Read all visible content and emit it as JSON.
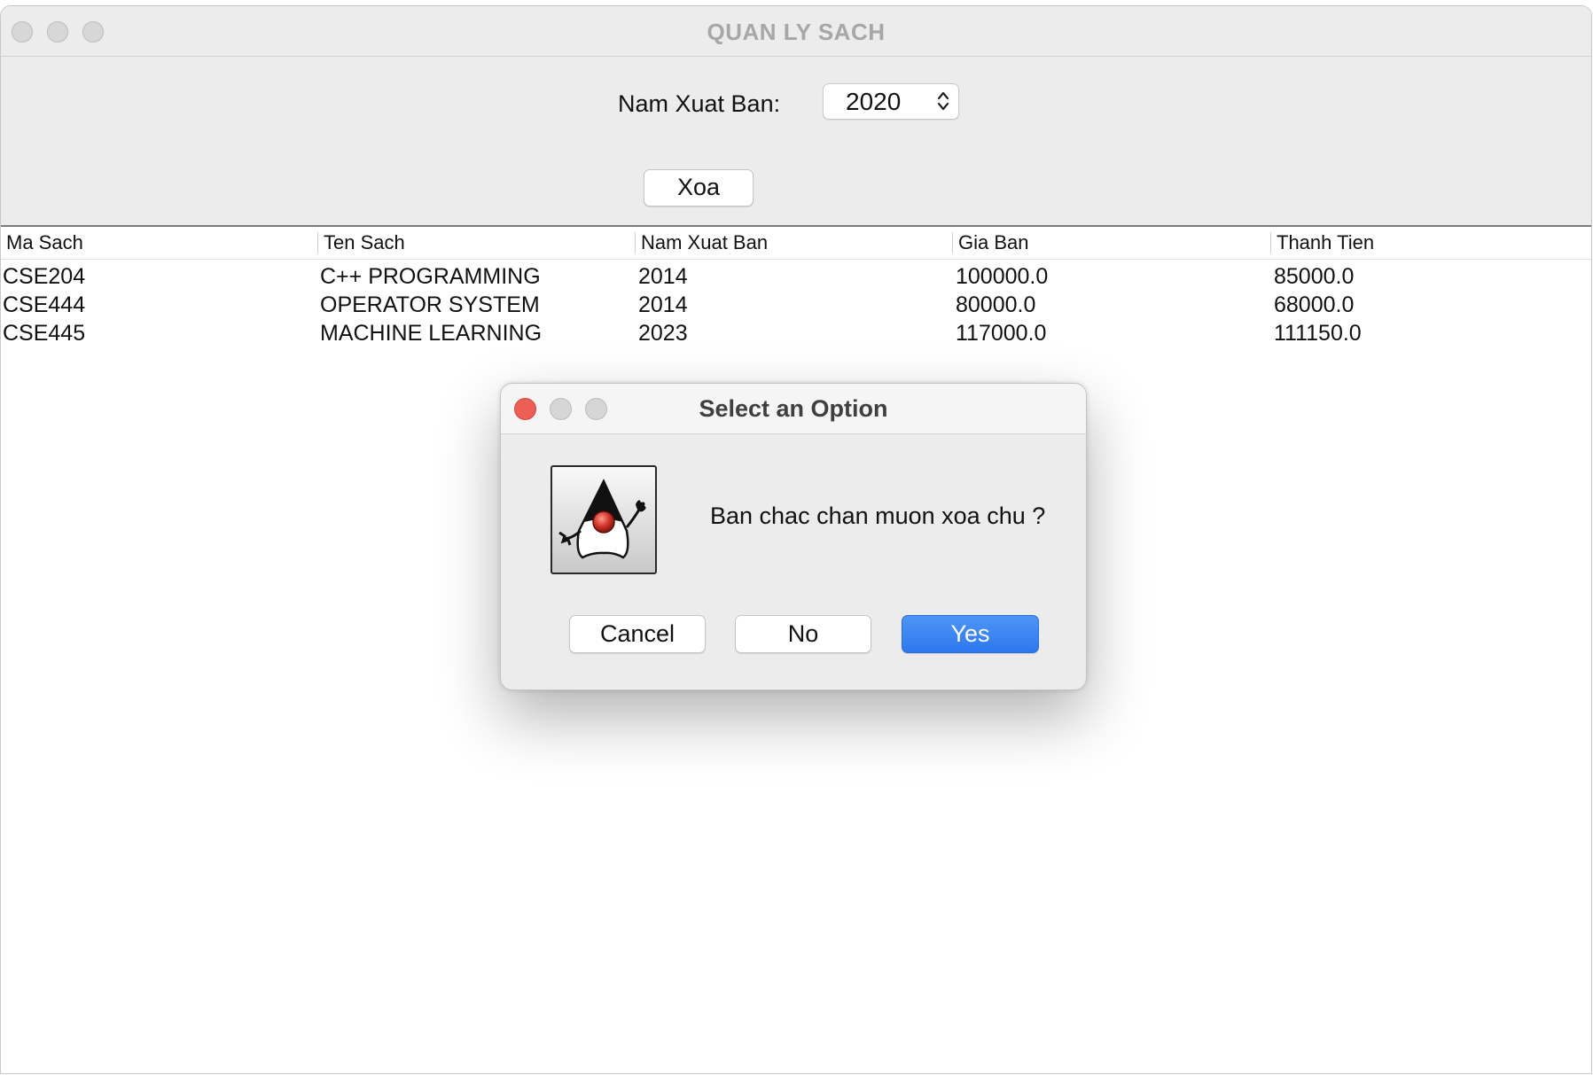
{
  "window": {
    "title": "QUAN LY SACH"
  },
  "filter": {
    "label": "Nam Xuat Ban:",
    "value": "2020"
  },
  "toolbar": {
    "delete_label": "Xoa"
  },
  "table": {
    "columns": [
      "Ma Sach",
      "Ten Sach",
      "Nam Xuat Ban",
      "Gia Ban",
      "Thanh Tien"
    ],
    "rows": [
      [
        "CSE204",
        "C++ PROGRAMMING",
        "2014",
        "100000.0",
        "85000.0"
      ],
      [
        "CSE444",
        "OPERATOR SYSTEM",
        "2014",
        "80000.0",
        "68000.0"
      ],
      [
        "CSE445",
        "MACHINE LEARNING",
        "2023",
        "117000.0",
        "111150.0"
      ]
    ]
  },
  "dialog": {
    "title": "Select an Option",
    "message": "Ban chac chan muon xoa chu ?",
    "cancel_label": "Cancel",
    "no_label": "No",
    "yes_label": "Yes",
    "icon": "java-duke-icon"
  },
  "colors": {
    "accent": "#2f7bf0",
    "close_red": "#ec5f55"
  }
}
